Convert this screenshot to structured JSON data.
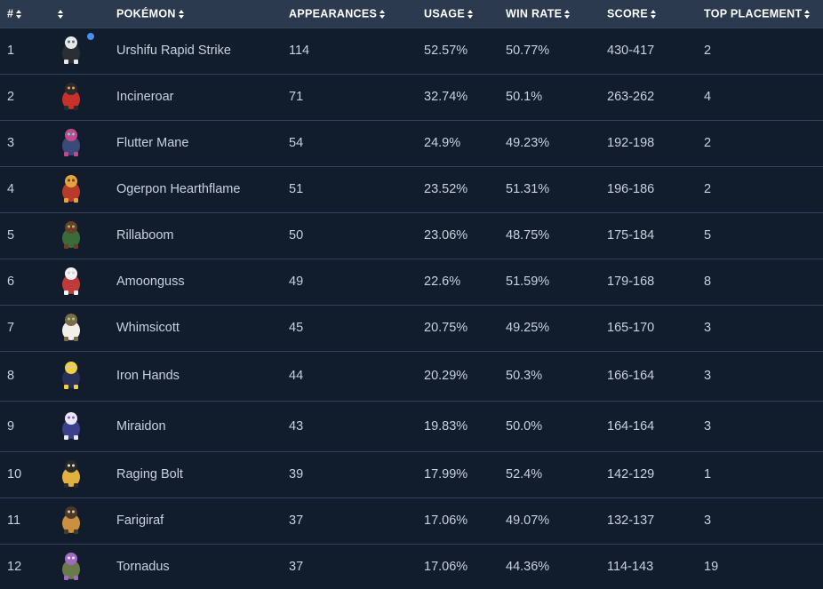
{
  "headers": {
    "rank": "#",
    "pokemon": "POKÉMON",
    "appearances": "APPEARANCES",
    "usage": "USAGE",
    "win_rate": "WIN RATE",
    "score": "SCORE",
    "top_placement": "TOP PLACEMENT"
  },
  "colors": {
    "background": "#111c2d",
    "header_bg": "#2b3a4f",
    "row_border": "#34445a",
    "text": "#c9d1dc",
    "indicator_dot": "#4a8df0"
  },
  "rows": [
    {
      "rank": "1",
      "icon": "urshifu-rapid-strike-icon",
      "name": "Urshifu Rapid Strike",
      "appearances": "114",
      "usage": "52.57%",
      "win_rate": "50.77%",
      "score": "430-417",
      "top_placement": "2",
      "indicator": true
    },
    {
      "rank": "2",
      "icon": "incineroar-icon",
      "name": "Incineroar",
      "appearances": "71",
      "usage": "32.74%",
      "win_rate": "50.1%",
      "score": "263-262",
      "top_placement": "4",
      "indicator": false
    },
    {
      "rank": "3",
      "icon": "flutter-mane-icon",
      "name": "Flutter Mane",
      "appearances": "54",
      "usage": "24.9%",
      "win_rate": "49.23%",
      "score": "192-198",
      "top_placement": "2",
      "indicator": false
    },
    {
      "rank": "4",
      "icon": "ogerpon-hearthflame-icon",
      "name": "Ogerpon Hearthflame",
      "appearances": "51",
      "usage": "23.52%",
      "win_rate": "51.31%",
      "score": "196-186",
      "top_placement": "2",
      "indicator": false
    },
    {
      "rank": "5",
      "icon": "rillaboom-icon",
      "name": "Rillaboom",
      "appearances": "50",
      "usage": "23.06%",
      "win_rate": "48.75%",
      "score": "175-184",
      "top_placement": "5",
      "indicator": false
    },
    {
      "rank": "6",
      "icon": "amoonguss-icon",
      "name": "Amoonguss",
      "appearances": "49",
      "usage": "22.6%",
      "win_rate": "51.59%",
      "score": "179-168",
      "top_placement": "8",
      "indicator": false
    },
    {
      "rank": "7",
      "icon": "whimsicott-icon",
      "name": "Whimsicott",
      "appearances": "45",
      "usage": "20.75%",
      "win_rate": "49.25%",
      "score": "165-170",
      "top_placement": "3",
      "indicator": false
    },
    {
      "rank": "8",
      "icon": "iron-hands-icon",
      "name": "Iron Hands",
      "appearances": "44",
      "usage": "20.29%",
      "win_rate": "50.3%",
      "score": "166-164",
      "top_placement": "3",
      "indicator": false
    },
    {
      "rank": "9",
      "icon": "miraidon-icon",
      "name": "Miraidon",
      "appearances": "43",
      "usage": "19.83%",
      "win_rate": "50.0%",
      "score": "164-164",
      "top_placement": "3",
      "indicator": false
    },
    {
      "rank": "10",
      "icon": "raging-bolt-icon",
      "name": "Raging Bolt",
      "appearances": "39",
      "usage": "17.99%",
      "win_rate": "52.4%",
      "score": "142-129",
      "top_placement": "1",
      "indicator": false
    },
    {
      "rank": "11",
      "icon": "farigiraf-icon",
      "name": "Farigiraf",
      "appearances": "37",
      "usage": "17.06%",
      "win_rate": "49.07%",
      "score": "132-137",
      "top_placement": "3",
      "indicator": false
    },
    {
      "rank": "12",
      "icon": "tornadus-icon",
      "name": "Tornadus",
      "appearances": "37",
      "usage": "17.06%",
      "win_rate": "44.36%",
      "score": "114-143",
      "top_placement": "19",
      "indicator": false
    }
  ]
}
